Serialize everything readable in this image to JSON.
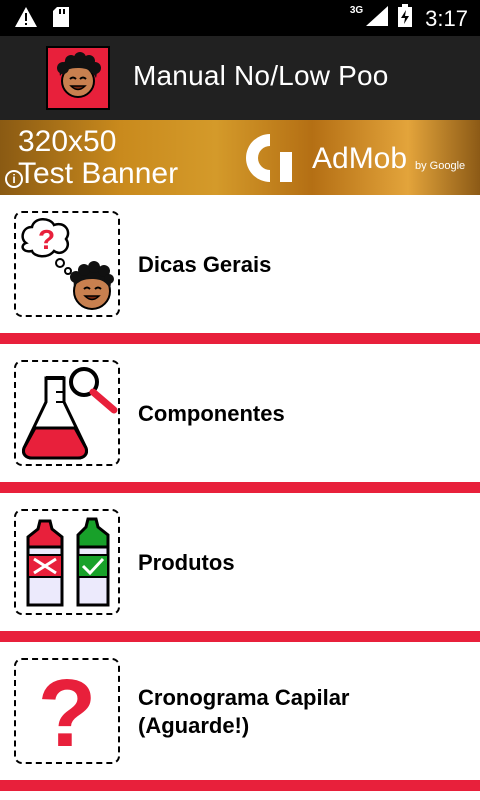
{
  "status_bar": {
    "network": "3G",
    "time": "3:17"
  },
  "app_bar": {
    "title": "Manual No/Low Poo"
  },
  "ad_banner": {
    "line1": "320x50",
    "line2": "Test Banner",
    "brand": "AdMob",
    "by": "by Google"
  },
  "menu": [
    {
      "label": "Dicas Gerais"
    },
    {
      "label": "Componentes"
    },
    {
      "label": "Produtos"
    },
    {
      "label": "Cronograma Capilar",
      "label2": "(Aguarde!)"
    }
  ],
  "colors": {
    "accent_red": "#e8203b",
    "app_bar": "#212121",
    "status_bar": "#000000",
    "green": "#18a12a"
  }
}
